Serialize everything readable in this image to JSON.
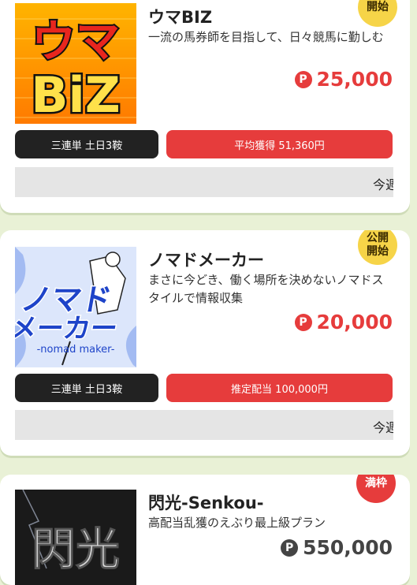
{
  "cards": [
    {
      "badge": [
        "開始"
      ],
      "title": "ウマBIZ",
      "description": "一流の馬券師を目指して、日々競馬に勤しむ",
      "price": "25,000",
      "price_mark": "P",
      "tag_left": "三連単 土日3鞍",
      "tag_right": "平均獲得 51,360円",
      "ticker": "今週",
      "thumb_text": [
        "ウマ",
        "BiZ"
      ]
    },
    {
      "badge": [
        "公開",
        "開始"
      ],
      "title": "ノマドメーカー",
      "description": "まさに今どき、働く場所を決めないノマドスタイルで情報収集",
      "price": "20,000",
      "price_mark": "P",
      "tag_left": "三連単 土日3鞍",
      "tag_right": "推定配当 100,000円",
      "ticker": "今週",
      "thumb_text": [
        "ノマド",
        "メーカー",
        "-nomad maker-"
      ]
    },
    {
      "badge": [
        "満枠"
      ],
      "title": "閃光-Senkou-",
      "description": "高配当乱獲のえぶり最上級プラン",
      "price": "550,000",
      "price_mark": "P",
      "thumb_text": [
        "閃光"
      ]
    }
  ],
  "colors": {
    "background": "#e9f1d6",
    "accent_red": "#e63c3c",
    "badge_yellow": "#f6d448",
    "tag_dark": "#222222"
  }
}
